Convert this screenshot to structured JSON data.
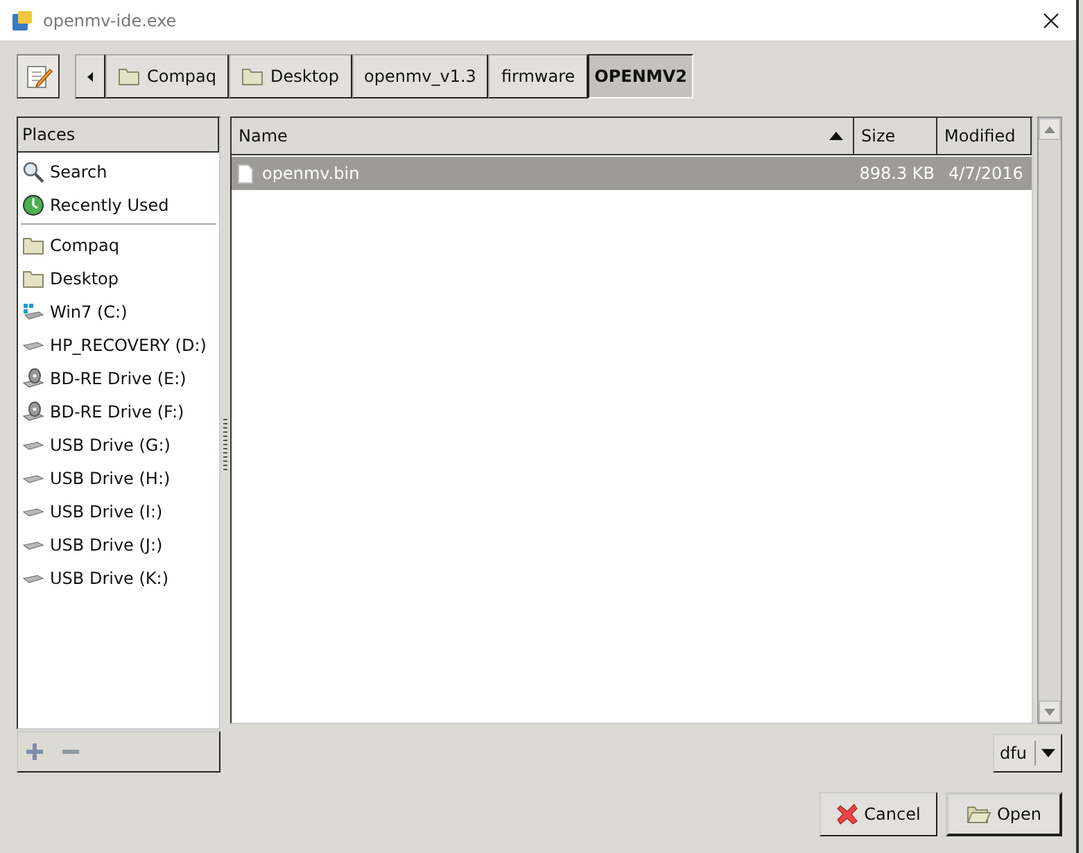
{
  "window": {
    "title": "openmv-ide.exe"
  },
  "path_bar": [
    {
      "label": "Compaq",
      "kind": "folder",
      "selected": false
    },
    {
      "label": "Desktop",
      "kind": "folder",
      "selected": false
    },
    {
      "label": "openmv_v1.3",
      "kind": "plain",
      "selected": false
    },
    {
      "label": "firmware",
      "kind": "plain",
      "selected": false
    },
    {
      "label": "OPENMV2",
      "kind": "plain",
      "selected": true
    }
  ],
  "places": {
    "title": "Places",
    "items": [
      {
        "label": "Search",
        "kind": "search"
      },
      {
        "label": "Recently Used",
        "kind": "recent"
      },
      {
        "kind": "separator"
      },
      {
        "label": "Compaq",
        "kind": "folder"
      },
      {
        "label": "Desktop",
        "kind": "folder"
      },
      {
        "label": "Win7 (C:)",
        "kind": "system-drive"
      },
      {
        "label": "HP_RECOVERY (D:)",
        "kind": "drive"
      },
      {
        "label": "BD-RE Drive (E:)",
        "kind": "optical"
      },
      {
        "label": "BD-RE Drive (F:)",
        "kind": "optical"
      },
      {
        "label": "USB Drive (G:)",
        "kind": "drive"
      },
      {
        "label": "USB Drive (H:)",
        "kind": "drive"
      },
      {
        "label": "USB Drive (I:)",
        "kind": "drive"
      },
      {
        "label": "USB Drive (J:)",
        "kind": "drive"
      },
      {
        "label": "USB Drive (K:)",
        "kind": "drive"
      }
    ]
  },
  "files": {
    "columns": [
      {
        "label": "Name",
        "sorted": true
      },
      {
        "label": "Size",
        "sorted": false
      },
      {
        "label": "Modified",
        "sorted": false
      }
    ],
    "rows": [
      {
        "name": "openmv.bin",
        "size": "898.3 KB",
        "modified": "4/7/2016",
        "selected": true
      }
    ]
  },
  "filter": {
    "value": "dfu"
  },
  "buttons": [
    {
      "label": "Cancel",
      "kind": "cancel"
    },
    {
      "label": "Open",
      "kind": "open"
    }
  ]
}
